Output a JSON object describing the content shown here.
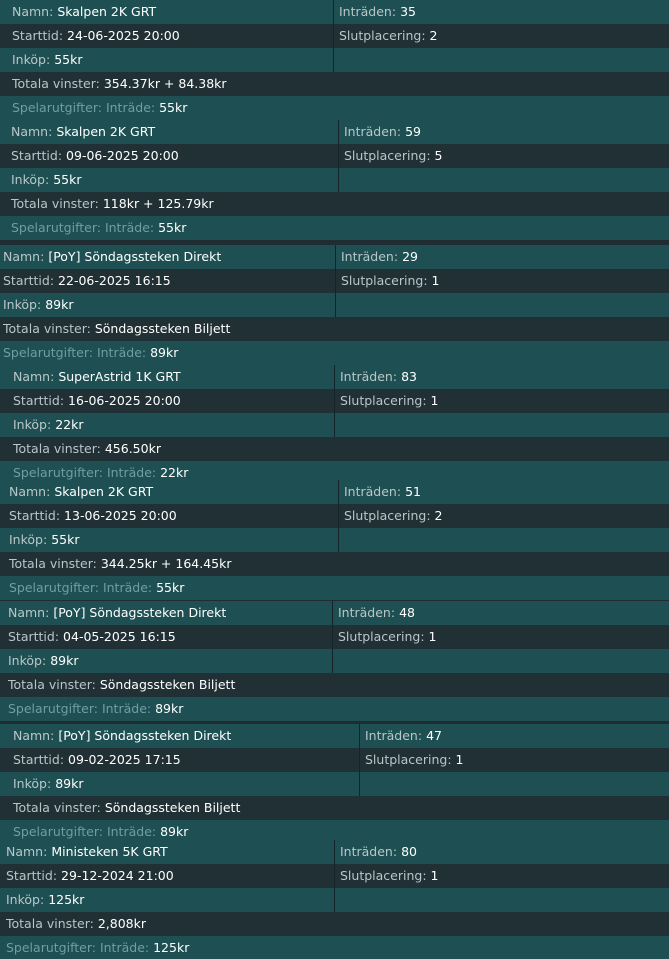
{
  "labels": {
    "name": "Namn:",
    "start": "Starttid:",
    "buyin": "Inköp:",
    "winnings": "Totala vinster:",
    "expenses": "Spelarutgifter:",
    "entry": "Inträde:",
    "entries": "Inträden:",
    "place": "Slutplacering:"
  },
  "tournaments": [
    {
      "name": "Skalpen 2K GRT",
      "start": "24-06-2025 20:00",
      "buyin": "55kr",
      "winnings": "354.37kr + 84.38kr",
      "entry_fee": "55kr",
      "entries": "35",
      "place": "2"
    },
    {
      "name": "Skalpen 2K GRT",
      "start": "09-06-2025 20:00",
      "buyin": "55kr",
      "winnings": "118kr + 125.79kr",
      "entry_fee": "55kr",
      "entries": "59",
      "place": "5"
    },
    {
      "name": "[PoY] Söndagssteken Direkt",
      "start": "22-06-2025 16:15",
      "buyin": "89kr",
      "winnings": "Söndagssteken Biljett",
      "entry_fee": "89kr",
      "entries": "29",
      "place": "1"
    },
    {
      "name": "SuperAstrid 1K GRT",
      "start": "16-06-2025 20:00",
      "buyin": "22kr",
      "winnings": "456.50kr",
      "entry_fee": "22kr",
      "entries": "83",
      "place": "1"
    },
    {
      "name": "Skalpen 2K GRT",
      "start": "13-06-2025 20:00",
      "buyin": "55kr",
      "winnings": "344.25kr + 164.45kr",
      "entry_fee": "55kr",
      "entries": "51",
      "place": "2"
    },
    {
      "name": "[PoY] Söndagssteken Direkt",
      "start": "04-05-2025 16:15",
      "buyin": "89kr",
      "winnings": "Söndagssteken Biljett",
      "entry_fee": "89kr",
      "entries": "48",
      "place": "1"
    },
    {
      "name": "[PoY] Söndagssteken Direkt",
      "start": "09-02-2025 17:15",
      "buyin": "89kr",
      "winnings": "Söndagssteken Biljett",
      "entry_fee": "89kr",
      "entries": "47",
      "place": "1"
    },
    {
      "name": "Ministeken 5K GRT",
      "start": "29-12-2024 21:00",
      "buyin": "125kr",
      "winnings": "2,808kr",
      "entry_fee": "125kr",
      "entries": "80",
      "place": "1"
    }
  ]
}
